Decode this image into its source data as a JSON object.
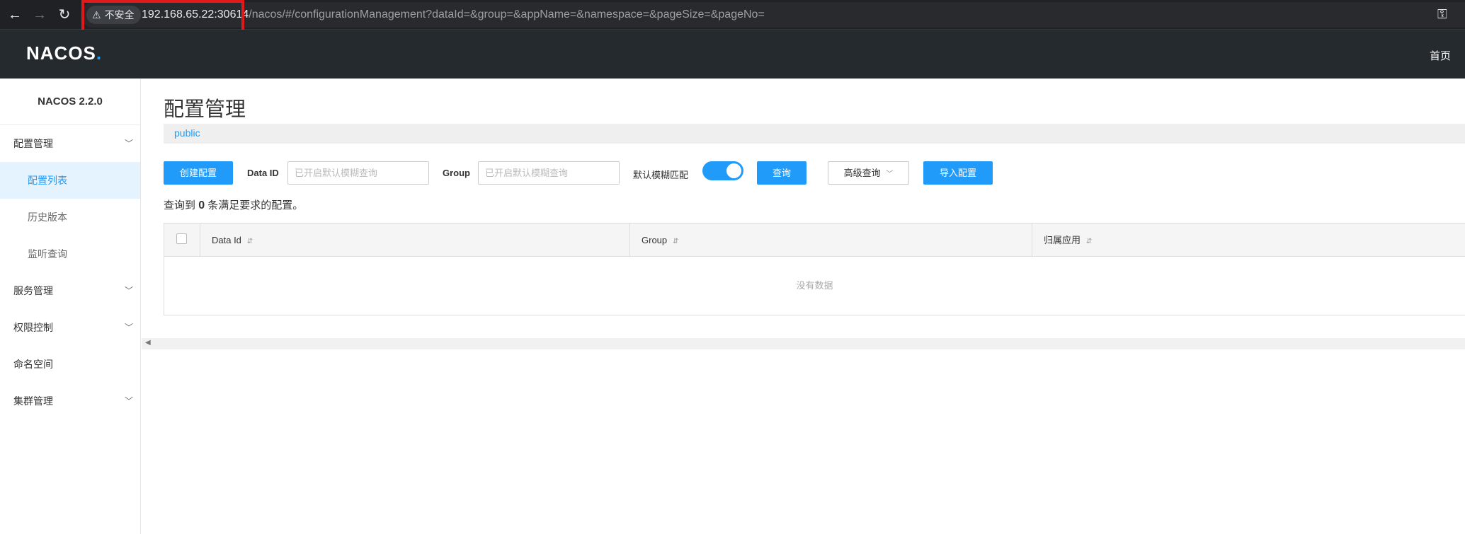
{
  "browser": {
    "security_label": "不安全",
    "url_host": "192.168.65.22",
    "url_port": ":30614",
    "url_path": "/nacos/#/configurationManagement?dataId=&group=&appName=&namespace=&pageSize=&pageNo=",
    "highlight_color": "#e0191b"
  },
  "header": {
    "logo_text": "NACOS",
    "logo_dot": ".",
    "home_label": "首页"
  },
  "sidebar": {
    "version": "NACOS 2.2.0",
    "items": [
      {
        "label": "配置管理",
        "type": "group"
      },
      {
        "label": "配置列表",
        "type": "sub",
        "active": true
      },
      {
        "label": "历史版本",
        "type": "sub"
      },
      {
        "label": "监听查询",
        "type": "sub"
      },
      {
        "label": "服务管理",
        "type": "group"
      },
      {
        "label": "权限控制",
        "type": "group"
      },
      {
        "label": "命名空间",
        "type": "item"
      },
      {
        "label": "集群管理",
        "type": "group"
      }
    ]
  },
  "main": {
    "title": "配置管理",
    "namespace": "public",
    "create_button": "创建配置",
    "data_id_label": "Data ID",
    "data_id_placeholder": "已开启默认模糊查询",
    "group_label": "Group",
    "group_placeholder": "已开启默认模糊查询",
    "fuzzy_label": "默认模糊匹配",
    "fuzzy_on": true,
    "query_button": "查询",
    "advanced_button": "高级查询",
    "import_button": "导入配置",
    "result_prefix": "查询到",
    "result_count": "0",
    "result_suffix": "条满足要求的配置。",
    "table": {
      "columns": [
        "Data Id",
        "Group",
        "归属应用"
      ],
      "empty_text": "没有数据"
    }
  },
  "colors": {
    "primary": "#209bfa",
    "header_bg": "#252a2f"
  }
}
